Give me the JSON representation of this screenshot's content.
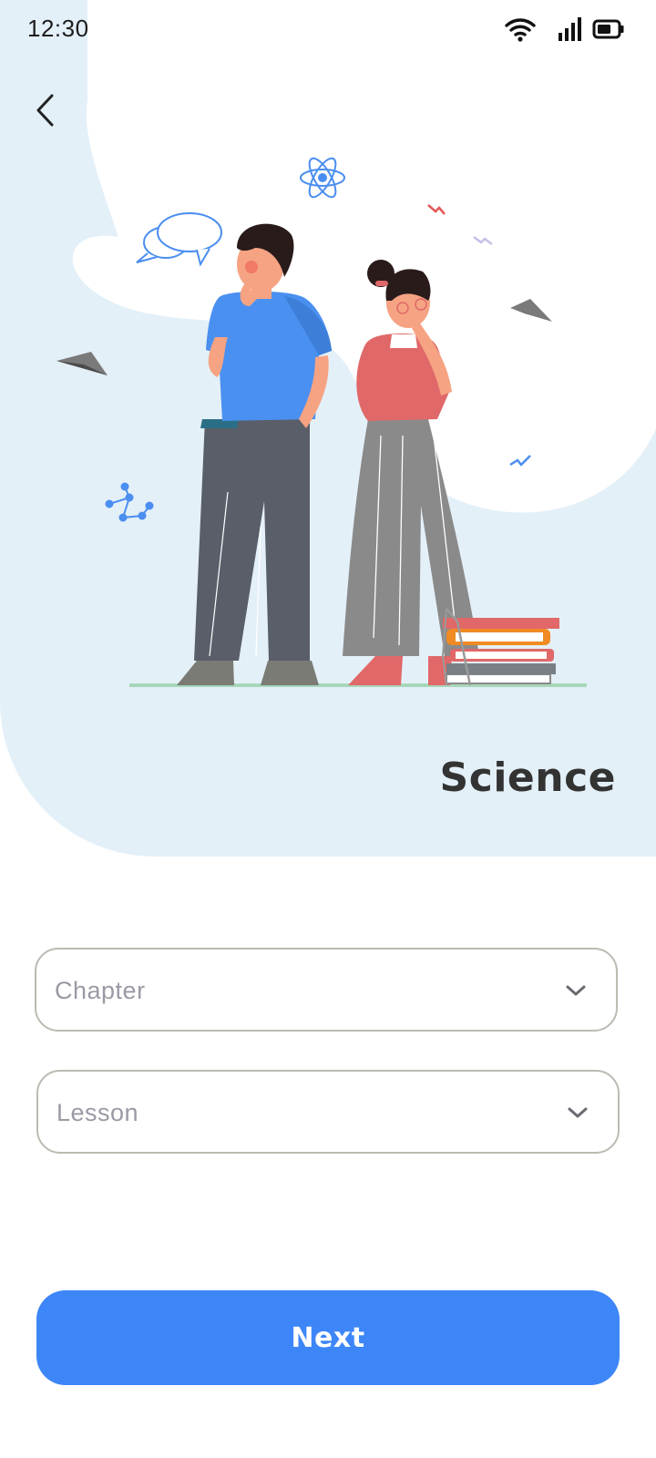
{
  "status_bar": {
    "time": "12:30",
    "icons": [
      "wifi-icon",
      "signal-icon",
      "battery-icon"
    ]
  },
  "header": {
    "back_icon": "chevron-left-icon"
  },
  "subject": {
    "title": "Science"
  },
  "form": {
    "chapter": {
      "placeholder": "Chapter",
      "icon": "chevron-down-icon"
    },
    "lesson": {
      "placeholder": "Lesson",
      "icon": "chevron-down-icon"
    }
  },
  "actions": {
    "next_label": "Next"
  },
  "colors": {
    "hero_background": "#e4f0f8",
    "accent": "#3d86f8",
    "title": "#333333",
    "placeholder": "#9a9aa6",
    "border": "#bdbab2"
  }
}
